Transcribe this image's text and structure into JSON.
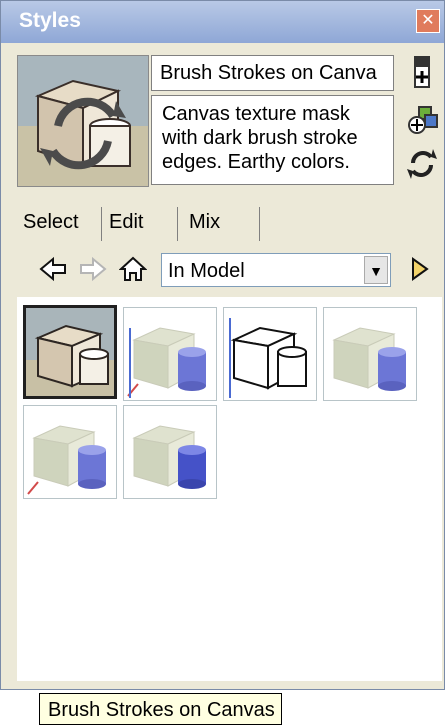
{
  "window": {
    "title": "Styles"
  },
  "style": {
    "name": "Brush Strokes on Canva",
    "description": "Canvas texture mask with dark brush stroke edges.  Earthy colors."
  },
  "tabs": [
    {
      "label": "Select"
    },
    {
      "label": "Edit"
    },
    {
      "label": "Mix"
    }
  ],
  "nav": {
    "collection": "In Model"
  },
  "gallery": {
    "tooltip": "Brush Strokes on Canvas",
    "items": [
      {
        "icon": "brush-strokes-style-icon"
      },
      {
        "icon": "shaded-style-icon"
      },
      {
        "icon": "sketch-style-icon"
      },
      {
        "icon": "shaded-style-icon"
      },
      {
        "icon": "shaded-style-icon"
      },
      {
        "icon": "shaded-style-icon"
      }
    ]
  },
  "colors": {
    "titlebar": "#8fa7d6",
    "accent_blue": "#5f6fd6",
    "panel": "#ece9d8"
  }
}
